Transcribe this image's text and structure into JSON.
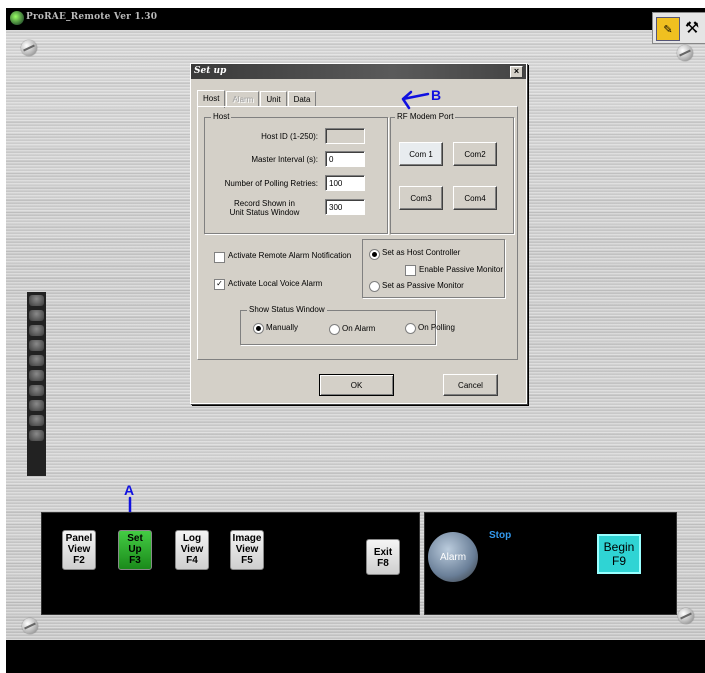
{
  "app": {
    "title": "ProRAE_Remote Ver 1.30"
  },
  "dialog": {
    "title": "Set up",
    "close_label": "×",
    "tabs": [
      {
        "label": "Host",
        "active": true
      },
      {
        "label": "Alarm",
        "disabled": true
      },
      {
        "label": "Unit"
      },
      {
        "label": "Data"
      }
    ],
    "host_group": {
      "legend": "Host",
      "host_id_label": "Host ID (1-250):",
      "host_id_value": "",
      "master_interval_label": "Master Interval (s):",
      "master_interval_value": "0",
      "polling_retries_label": "Number of Polling Retries:",
      "polling_retries_value": "100",
      "record_shown_label_1": "Record Shown in",
      "record_shown_label_2": "Unit Status Window",
      "record_shown_value": "300"
    },
    "rf_group": {
      "legend": "RF Modem Port",
      "ports": [
        "Com 1",
        "Com2",
        "Com3",
        "Com4"
      ]
    },
    "checks": {
      "remote_alarm": {
        "label": "Activate Remote Alarm Notification",
        "checked": false
      },
      "local_voice": {
        "label": "Activate Local Voice Alarm",
        "checked": true
      }
    },
    "mode": {
      "host_controller": "Set as Host Controller",
      "enable_passive": "Enable Passive Monitor",
      "passive_monitor": "Set as Passive Monitor"
    },
    "status_window": {
      "legend": "Show Status Window",
      "options": [
        "Manually",
        "On Alarm",
        "On Polling"
      ],
      "selected": "Manually"
    },
    "ok_label": "OK",
    "cancel_label": "Cancel"
  },
  "annotations": {
    "a": "A",
    "b": "B"
  },
  "panel": {
    "keys": [
      {
        "line1": "Panel",
        "line2": "View",
        "line3": "F2"
      },
      {
        "line1": "Set",
        "line2": "Up",
        "line3": "F3"
      },
      {
        "line1": "Log",
        "line2": "View",
        "line3": "F4"
      },
      {
        "line1": "Image",
        "line2": "View",
        "line3": "F5"
      }
    ],
    "exit": {
      "line1": "Exit",
      "line2": "F8"
    },
    "alarm_label": "Alarm",
    "stop_label": "Stop",
    "begin": {
      "line1": "Begin",
      "line2": "F9"
    }
  },
  "colors": {
    "annotation": "#1010e0",
    "begin": "#2fd4d4",
    "selected_key": "#22aa22"
  }
}
